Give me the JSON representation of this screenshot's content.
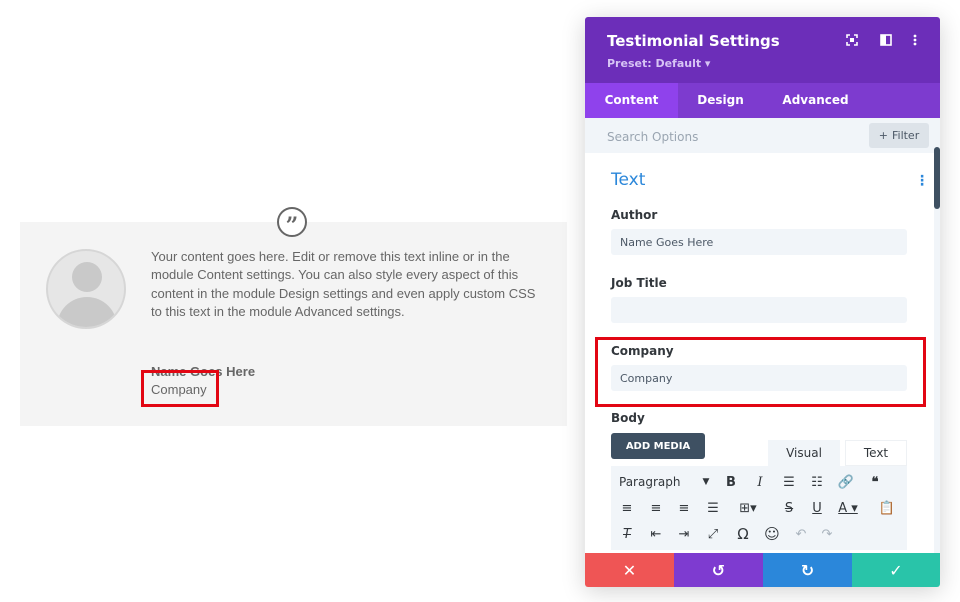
{
  "preview": {
    "body": "Your content goes here. Edit or remove this text inline or in the module Content settings. You can also style every aspect of this content in the module Design settings and even apply custom CSS to this text in the module Advanced settings.",
    "author": "Name Goes Here",
    "company": "Company",
    "quote_icon": "quote-icon"
  },
  "panel": {
    "title": "Testimonial Settings",
    "preset": "Preset: Default ▾",
    "tabs": [
      {
        "label": "Content",
        "active": true
      },
      {
        "label": "Design",
        "active": false
      },
      {
        "label": "Advanced",
        "active": false
      }
    ],
    "search_placeholder": "Search Options",
    "filter_label": "Filter",
    "section_title": "Text",
    "fields": {
      "author": {
        "label": "Author",
        "value": "Name Goes Here"
      },
      "job_title": {
        "label": "Job Title",
        "value": ""
      },
      "company": {
        "label": "Company",
        "value": "Company"
      },
      "body": {
        "label": "Body"
      }
    },
    "add_media_label": "ADD MEDIA",
    "editor_tabs": {
      "visual": "Visual",
      "text": "Text"
    },
    "paragraph_label": "Paragraph"
  },
  "colors": {
    "header": "#6c2eb9",
    "tab_active": "#8f42ec",
    "accent_blue": "#2b87da",
    "highlight_red": "#e20613",
    "cancel": "#ef5555",
    "undo": "#7e3bd0",
    "redo": "#2b87da",
    "save": "#29c4a9"
  }
}
